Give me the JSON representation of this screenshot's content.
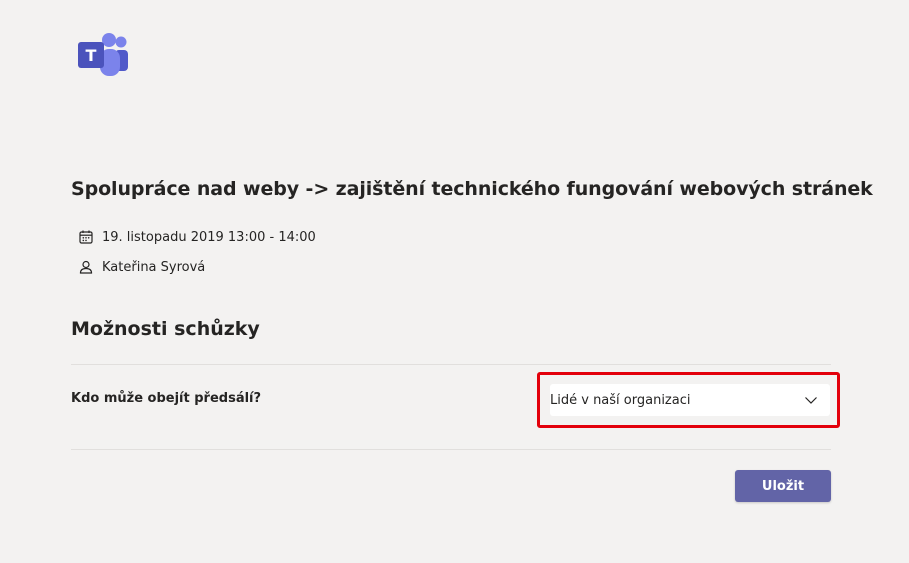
{
  "app": {
    "logo_icon": "microsoft-teams-logo",
    "accent_color": "#6264a7"
  },
  "meeting": {
    "title": "Spolupráce nad weby -> zajištění technického fungování webových stránek",
    "date_icon": "calendar-icon",
    "datetime": "19. listopadu 2019 13:00 - 14:00",
    "organizer_icon": "person-icon",
    "organizer": "Kateřina Syrová"
  },
  "options": {
    "section_title": "Možnosti schůzky",
    "lobby_bypass": {
      "label": "Kdo může obejít předsálí?",
      "selected_value": "Lidé v naší organizaci",
      "dropdown_icon": "chevron-down-icon"
    },
    "highlight_color": "#e3000b"
  },
  "actions": {
    "save_label": "Uložit"
  }
}
